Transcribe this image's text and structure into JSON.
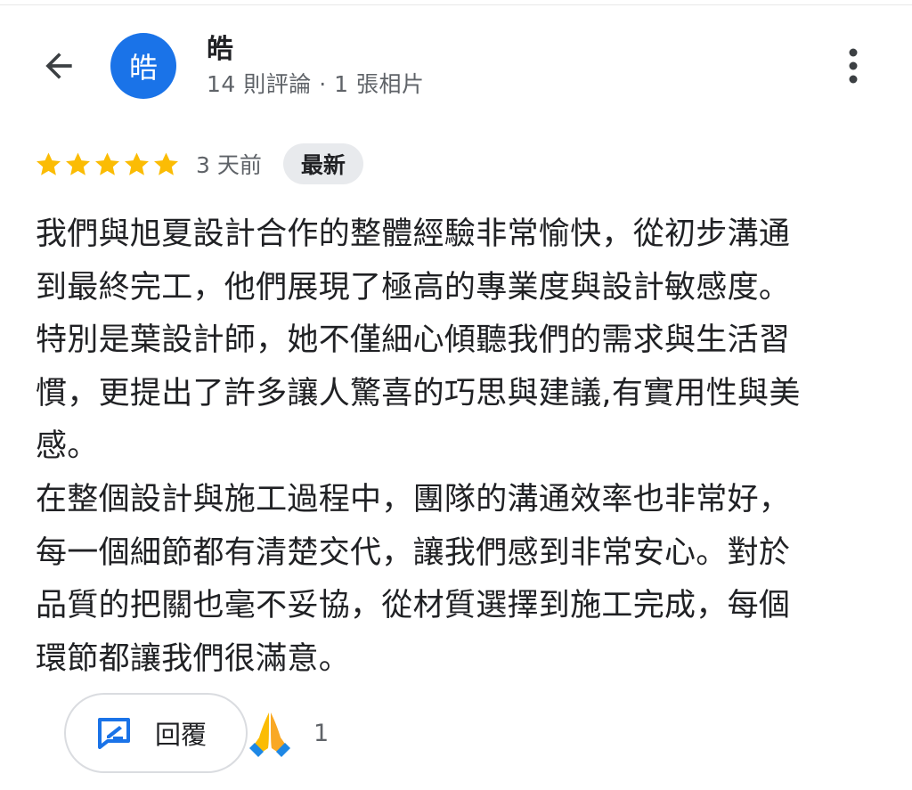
{
  "header": {
    "avatar_letter": "皓",
    "user_name": "皓",
    "user_meta": "14 則評論 · 1 張相片"
  },
  "review": {
    "rating": 5,
    "max_rating": 5,
    "time_ago": "3 天前",
    "badge": "最新",
    "text": "我們與旭夏設計合作的整體經驗非常愉快，從初步溝通\n到最終完工，他們展現了極高的專業度與設計敏感度。\n特別是葉設計師，她不僅細心傾聽我們的需求與生活習\n慣，更提出了許多讓人驚喜的巧思與建議,有實用性與美\n感。\n在整個設計與施工過程中，團隊的溝通效率也非常好，\n每一個細節都有清楚交代，讓我們感到非常安心。對於\n品質的把關也毫不妥協，從材質選擇到施工完成，每個\n環節都讓我們很滿意。"
  },
  "actions": {
    "reply_label": "回覆",
    "reaction_count": "1"
  },
  "colors": {
    "avatar_bg": "#1a73e8",
    "star": "#fbbc04",
    "reply_icon": "#1a73e8"
  },
  "icons": {
    "back": "arrow-left-icon",
    "more": "more-vert-icon",
    "reply": "reply-edit-icon",
    "reaction": "folded-hands-icon"
  }
}
